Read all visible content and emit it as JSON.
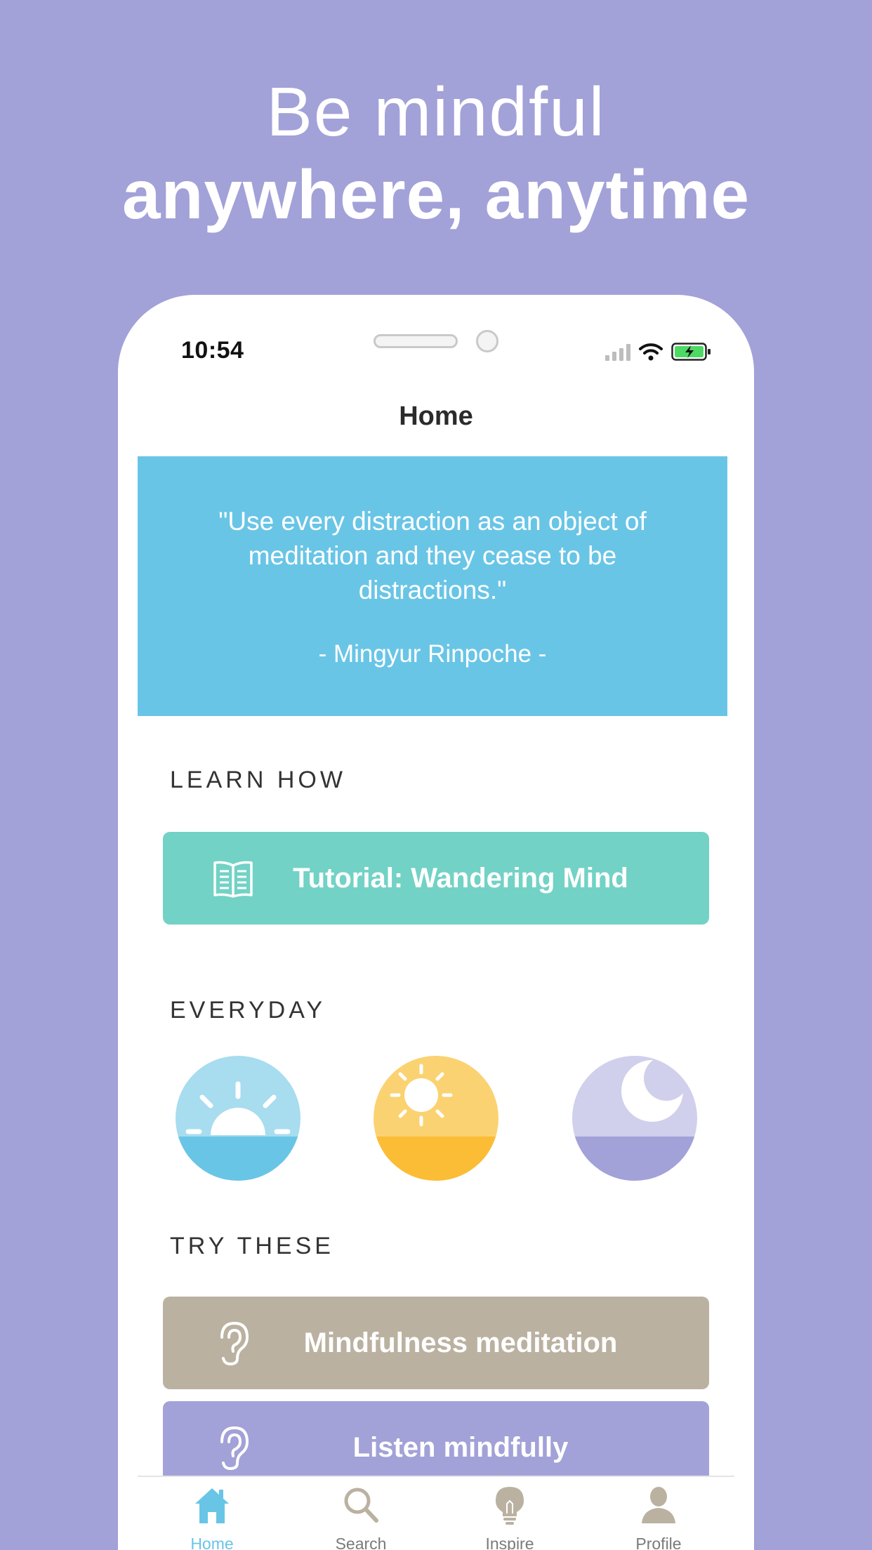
{
  "hero": {
    "line1": "Be mindful",
    "line2": "anywhere, anytime"
  },
  "status_bar": {
    "time": "10:54"
  },
  "nav": {
    "title": "Home"
  },
  "quote": {
    "text": "\"Use every distraction as an object of meditation and they cease to be distractions.\"",
    "author": "- Mingyur Rinpoche -"
  },
  "sections": {
    "learn_how": "LEARN HOW",
    "everyday": "EVERYDAY",
    "try_these": "TRY THESE"
  },
  "buttons": {
    "tutorial": "Tutorial: Wandering Mind",
    "mindfulness": "Mindfulness meditation",
    "listen": "Listen mindfully"
  },
  "everyday_items": [
    {
      "icon": "sunrise-icon"
    },
    {
      "icon": "sun-icon"
    },
    {
      "icon": "moon-icon"
    }
  ],
  "tabs": [
    {
      "label": "Home",
      "icon": "home-icon",
      "active": true
    },
    {
      "label": "Search",
      "icon": "search-icon",
      "active": false
    },
    {
      "label": "Inspire",
      "icon": "lightbulb-icon",
      "active": false
    },
    {
      "label": "Profile",
      "icon": "profile-icon",
      "active": false
    }
  ],
  "colors": {
    "background": "#a2a1d8",
    "quote": "#69c5e6",
    "tutorial": "#72d2c5",
    "mindfulness": "#bab1a1",
    "listen": "#a2a1d8",
    "active_tab": "#69c5e6"
  }
}
